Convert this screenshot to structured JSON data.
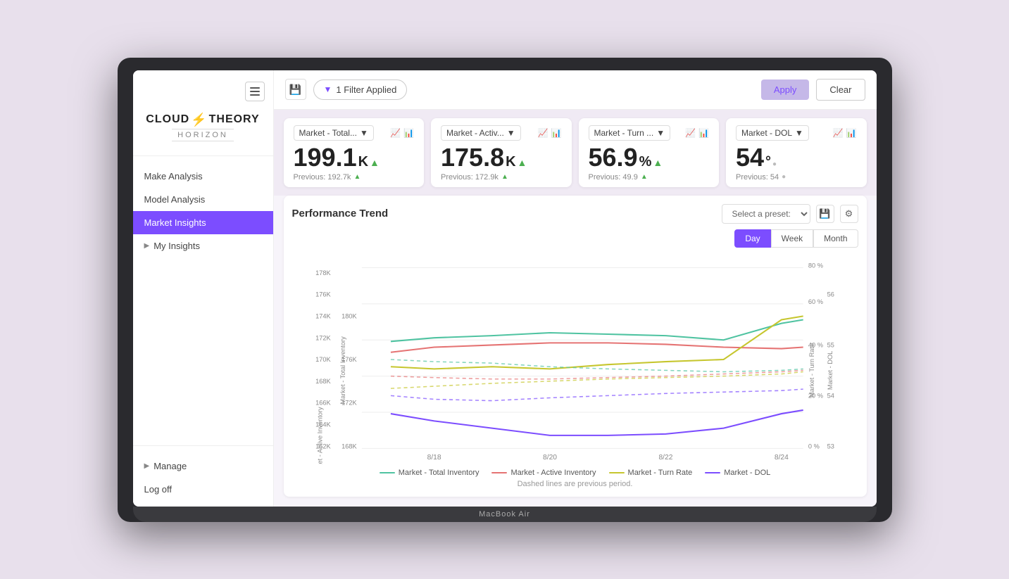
{
  "laptop": {
    "model": "MacBook Air"
  },
  "sidebar": {
    "logo_main": "CLOUD⚡THEORY",
    "logo_sub": "HORIZON",
    "nav_items": [
      {
        "id": "make-analysis",
        "label": "Make Analysis",
        "active": false,
        "expandable": false
      },
      {
        "id": "model-analysis",
        "label": "Model Analysis",
        "active": false,
        "expandable": false
      },
      {
        "id": "market-insights",
        "label": "Market Insights",
        "active": true,
        "expandable": false
      },
      {
        "id": "my-insights",
        "label": "My Insights",
        "active": false,
        "expandable": true
      }
    ],
    "bottom_items": [
      {
        "id": "manage",
        "label": "Manage",
        "expandable": true
      },
      {
        "id": "log-off",
        "label": "Log off",
        "expandable": false
      }
    ]
  },
  "toolbar": {
    "filter_label": "1 Filter Applied",
    "apply_label": "Apply",
    "clear_label": "Clear"
  },
  "kpi_cards": [
    {
      "id": "total-inventory",
      "dropdown_label": "Market - Total...",
      "value": "199.1",
      "unit": "K",
      "trend": "up",
      "prev_label": "Previous: 192.7k",
      "prev_trend": "up"
    },
    {
      "id": "active-inventory",
      "dropdown_label": "Market - Activ...",
      "value": "175.8",
      "unit": "K",
      "trend": "up",
      "prev_label": "Previous: 172.9k",
      "prev_trend": "up"
    },
    {
      "id": "turn-rate",
      "dropdown_label": "Market - Turn ...",
      "value": "56.9",
      "unit": "%",
      "trend": "up",
      "prev_label": "Previous: 49.9",
      "prev_trend": "up"
    },
    {
      "id": "dol",
      "dropdown_label": "Market - DOL",
      "value": "54",
      "unit": "°",
      "trend": "neutral",
      "prev_label": "Previous: 54",
      "prev_trend": "neutral"
    }
  ],
  "chart": {
    "title": "Performance Trend",
    "preset_placeholder": "Select a preset:",
    "period_tabs": [
      "Day",
      "Week",
      "Month"
    ],
    "active_period": "Day",
    "legend": [
      {
        "label": "Market - Total Inventory",
        "color": "#4fc3a1",
        "dashed": false
      },
      {
        "label": "Market - Active Inventory",
        "color": "#e57373",
        "dashed": false
      },
      {
        "label": "Market - Turn Rate",
        "color": "#c6c62e",
        "dashed": false
      },
      {
        "label": "Market - DOL",
        "color": "#7c4dff",
        "dashed": false
      }
    ],
    "note": "Dashed lines are previous period.",
    "x_labels": [
      "8/18",
      "8/20",
      "8/22",
      "8/24"
    ],
    "y_left_labels": [
      "162K",
      "164K",
      "166K",
      "168K",
      "170K",
      "172K",
      "174K",
      "176K",
      "178K",
      "180K"
    ],
    "y_right1_labels": [
      "20 %",
      "40 %",
      "60 %",
      "80 %"
    ],
    "y_right2_labels": [
      "53",
      "54",
      "55",
      "56"
    ]
  }
}
